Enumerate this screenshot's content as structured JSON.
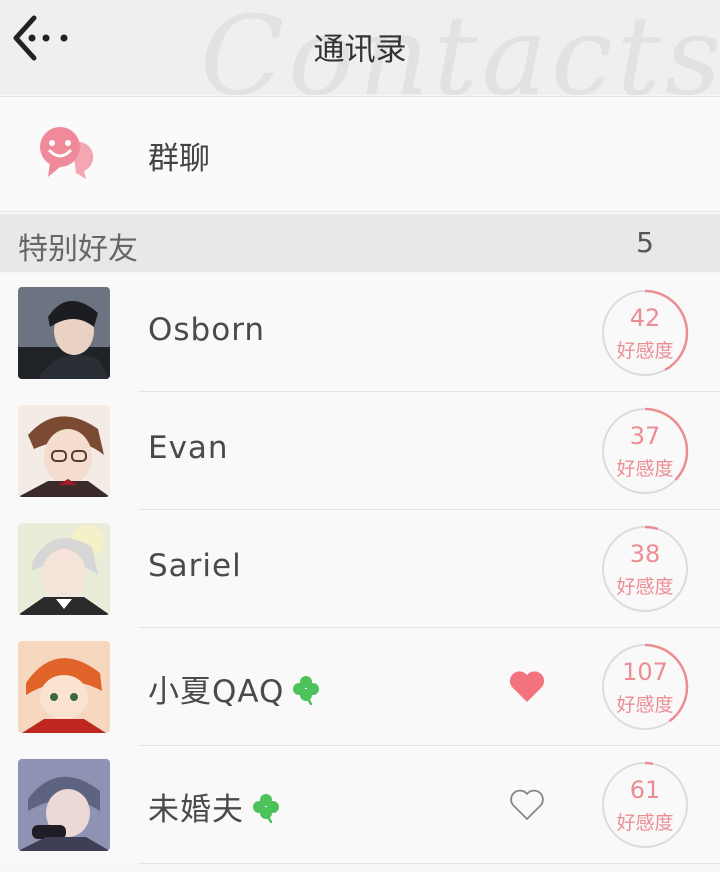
{
  "header": {
    "title": "通讯录",
    "background_word": "Contacts",
    "back_icon": "back-arrow-icon"
  },
  "group_chat": {
    "label": "群聊",
    "icon": "group-chat-icon",
    "icon_color": "#f08a9a"
  },
  "section": {
    "label": "特别好友",
    "count": "5"
  },
  "favorability_label": "好感度",
  "colors": {
    "accent_pink": "#ec8d94",
    "heart_filled": "#f2737e",
    "clover_green": "#4cc25a",
    "ring_track": "#dcdcdc"
  },
  "contacts": [
    {
      "name": "Osborn",
      "favorability": "42",
      "progress": 0.42,
      "badge": false,
      "heart": "none"
    },
    {
      "name": "Evan",
      "favorability": "37",
      "progress": 0.37,
      "badge": false,
      "heart": "none"
    },
    {
      "name": "Sariel",
      "favorability": "38",
      "progress": 0.05,
      "badge": false,
      "heart": "none"
    },
    {
      "name": "小夏QAQ",
      "favorability": "107",
      "progress": 0.4,
      "badge": true,
      "heart": "filled"
    },
    {
      "name": "未婚夫",
      "favorability": "61",
      "progress": 0.03,
      "badge": true,
      "heart": "outline"
    }
  ]
}
